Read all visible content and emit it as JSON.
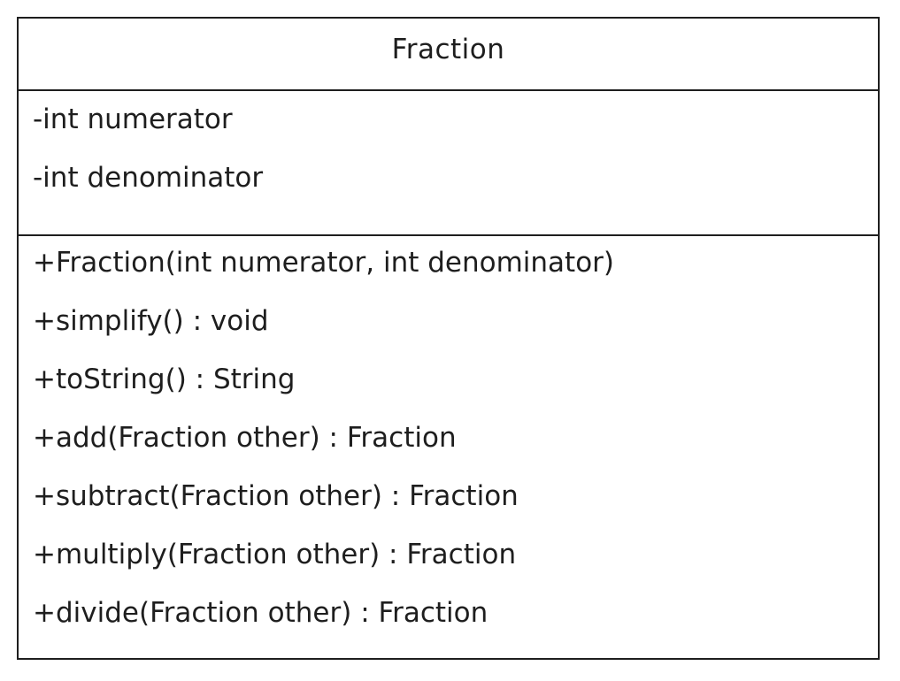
{
  "class_name": "Fraction",
  "attributes": [
    "-int numerator",
    "-int denominator"
  ],
  "methods": [
    "+Fraction(int numerator, int denominator)",
    "+simplify() : void",
    "+toString() : String",
    "+add(Fraction other) : Fraction",
    "+subtract(Fraction other) : Fraction",
    "+multiply(Fraction other) : Fraction",
    "+divide(Fraction other) : Fraction"
  ]
}
